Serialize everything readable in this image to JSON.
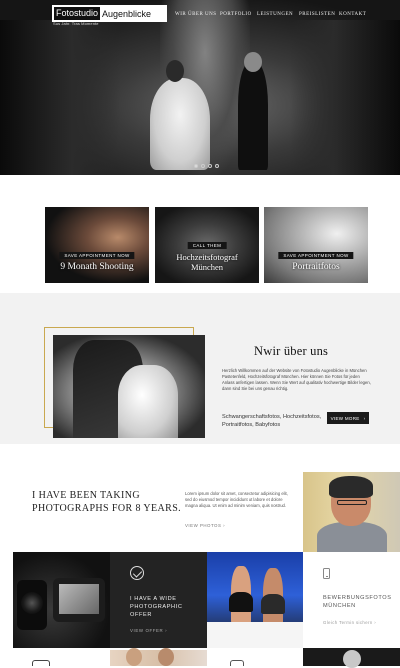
{
  "header": {
    "logo_part1": "Fotostudio",
    "logo_part2": "Augenblicke",
    "logo_sub": "Sus Jahr. Tras Momente",
    "nav": [
      "WIR ÜBER UNS",
      "PORTFOLIO",
      "LEISTUNGEN",
      "PREISLISTEN",
      "KONTAKT"
    ]
  },
  "slider": {
    "slides": 4,
    "active": 1
  },
  "services": [
    {
      "pill": "SAVE APPOINTMENT NOW",
      "title": "9 Monath Shooting"
    },
    {
      "pill": "CALL THEM",
      "title": "Hochzeitsfotograf München"
    },
    {
      "pill": "SAVE APPOINTMENT NOW",
      "title": "Portraitfotos"
    }
  ],
  "about": {
    "heading": "Nwir über uns",
    "text": "Herzlich Willkommen auf der Website von Fotostudio Augenblicke in München Pasteten­feld, Hochzeitsfotograf München. Hier können Sie Fotos für jeden Anlass anfertigen lassen. Wenn Sie Wert auf qualitativ hochwertige Bilder legen, dann sind Sie bei uns genau richtig.",
    "types": "Schwangerschaftsfotos, Hochzeitsfotos, Portraitfotos, Babyfotos",
    "button": "VIEW MORE"
  },
  "experience": {
    "headline": "I have been taking photographs for 8 years.",
    "lorem": "Lorem ipsum dolor sit amet, consectetur adipisicing elit, sed do eiusmod tempor incididunt ut labore et dolore magna aliqua. Ut enim ad minim veniam, quis nostrud.",
    "link": "VIEW PHOTOS"
  },
  "offer": {
    "text": "I have a wide photographic offer",
    "link": "VIEW OFFER"
  },
  "application": {
    "title": "Bewerbungsfotos München",
    "link": "Gleich Termin sichern"
  }
}
